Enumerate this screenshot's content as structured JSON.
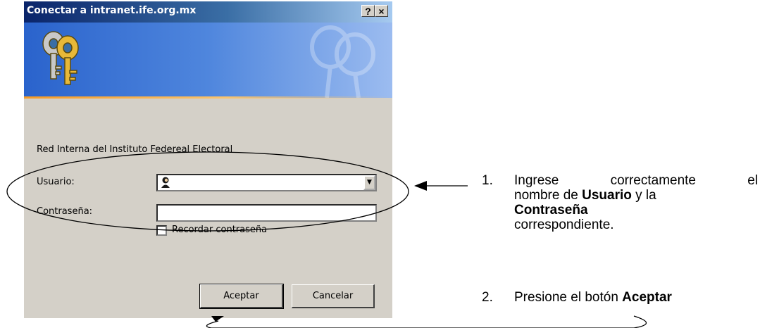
{
  "dialog": {
    "title": "Conectar a intranet.ife.org.mx",
    "help_button": "?",
    "close_button": "×",
    "realm_text": "Red Interna del Instituto Federeal Electoral",
    "username_label": "Usuario:",
    "username_value": "",
    "password_label": "Contraseña:",
    "password_value": "",
    "remember_label": "Recordar contraseña",
    "remember_checked": false,
    "ok_button": "Aceptar",
    "cancel_button": "Cancelar",
    "icons": [
      "keys-icon",
      "user-icon",
      "dropdown-arrow-icon"
    ]
  },
  "annotations": {
    "step1": {
      "number": "1.",
      "word_ingrese": "Ingrese",
      "word_correctamente": "correctamente",
      "word_el": "el",
      "text_nombre_de": "nombre de ",
      "bold_usuario": "Usuario",
      "text_y_la": " y la",
      "bold_contrasena": "Contraseña",
      "text_correspondiente": "correspondiente."
    },
    "step2": {
      "number": "2.",
      "text": "Presione el botón ",
      "bold_aceptar": "Aceptar"
    }
  }
}
